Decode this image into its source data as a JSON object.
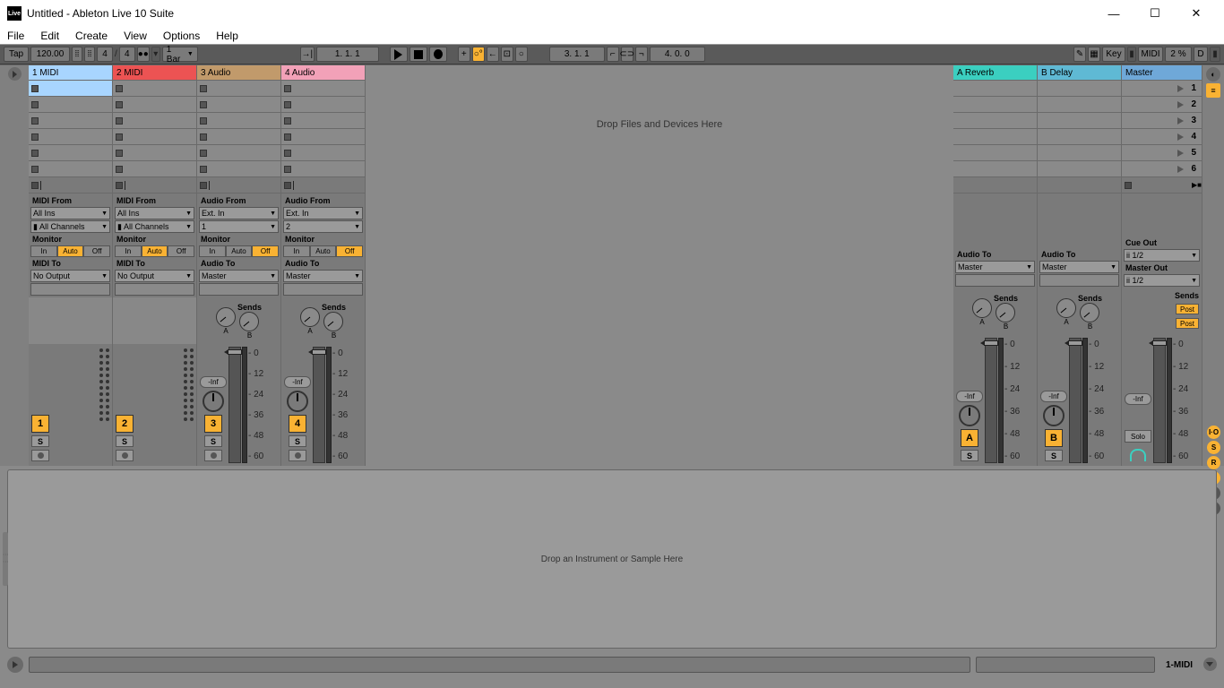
{
  "window": {
    "title": "Untitled - Ableton Live 10 Suite",
    "icon": "Live"
  },
  "menu": [
    "File",
    "Edit",
    "Create",
    "View",
    "Options",
    "Help"
  ],
  "transport": {
    "tap": "Tap",
    "tempo": "120.00",
    "sig_num": "4",
    "sig_den": "4",
    "quantize": "1 Bar",
    "position": "1.   1.   1",
    "loop_pos": "3.   1.   1",
    "loop_len": "4.   0.   0",
    "key": "Key",
    "midi": "MIDI",
    "cpu": "2 %",
    "d": "D"
  },
  "tracks": [
    {
      "name": "1 MIDI",
      "color": "orange",
      "selected": true,
      "from_label": "MIDI From",
      "from": "All Ins",
      "channel": "All Channels",
      "monitor": "Auto",
      "to_label": "MIDI To",
      "to": "No Output",
      "num": "1",
      "vol": "",
      "type": "midi"
    },
    {
      "name": "2 MIDI",
      "color": "red",
      "from_label": "MIDI From",
      "from": "All Ins",
      "channel": "All Channels",
      "monitor": "Auto",
      "to_label": "MIDI To",
      "to": "No Output",
      "num": "2",
      "vol": "",
      "type": "midi"
    },
    {
      "name": "3 Audio",
      "color": "brown",
      "from_label": "Audio From",
      "from": "Ext. In",
      "channel": "1",
      "monitor": "Off",
      "to_label": "Audio To",
      "to": "Master",
      "num": "3",
      "vol": "-Inf",
      "type": "audio"
    },
    {
      "name": "4 Audio",
      "color": "pink",
      "from_label": "Audio From",
      "from": "Ext. In",
      "channel": "2",
      "monitor": "Off",
      "to_label": "Audio To",
      "to": "Master",
      "num": "4",
      "vol": "-Inf",
      "type": "audio"
    }
  ],
  "returns": [
    {
      "name": "A Reverb",
      "color": "teal",
      "to_label": "Audio To",
      "to": "Master",
      "num": "A",
      "vol": "-Inf"
    },
    {
      "name": "B Delay",
      "color": "teal2",
      "to_label": "Audio To",
      "to": "Master",
      "num": "B",
      "vol": "-Inf"
    }
  ],
  "master": {
    "name": "Master",
    "cue_label": "Cue Out",
    "cue": "ii 1/2",
    "out_label": "Master Out",
    "out": "ii 1/2",
    "vol": "-Inf",
    "solo": "Solo"
  },
  "scenes": [
    "1",
    "2",
    "3",
    "4",
    "5",
    "6"
  ],
  "sends_label": "Sends",
  "monitor_opts": [
    "In",
    "Auto",
    "Off"
  ],
  "db_scale": [
    "0",
    "12",
    "24",
    "36",
    "48",
    "60"
  ],
  "post": "Post",
  "s_label": "S",
  "drop_main": "Drop Files and Devices Here",
  "drop_device": "Drop an Instrument or Sample Here",
  "status_track": "1-MIDI",
  "send_letters": [
    "A",
    "B"
  ]
}
